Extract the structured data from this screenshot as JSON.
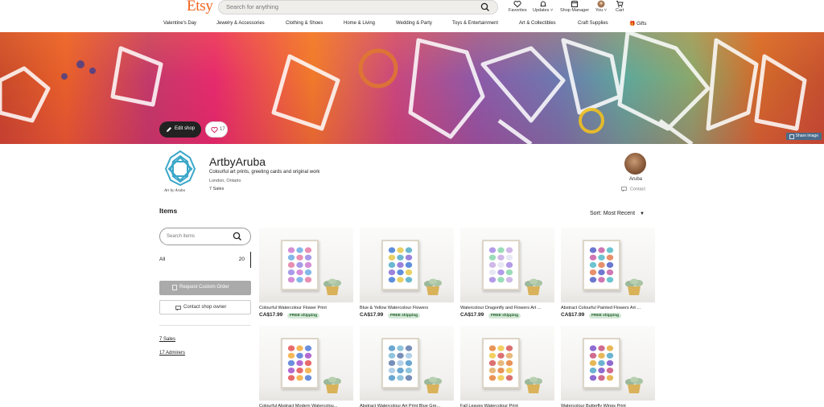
{
  "header": {
    "logo": "Etsy",
    "search_placeholder": "Search for anything",
    "icons": [
      {
        "label": "Favorites",
        "icon": "heart-icon"
      },
      {
        "label": "Updates ˅",
        "icon": "bell-icon"
      },
      {
        "label": "Shop Manager",
        "icon": "shop-icon"
      },
      {
        "label": "You ˅",
        "icon": "avatar-icon"
      },
      {
        "label": "Cart",
        "icon": "cart-icon"
      }
    ]
  },
  "categories": [
    "Valentine's Day",
    "Jewelry & Accessories",
    "Clothing & Shoes",
    "Home & Living",
    "Wedding & Party",
    "Toys & Entertainment",
    "Art & Collectibles",
    "Craft Supplies",
    "Gifts"
  ],
  "banner": {
    "edit_shop": "Edit shop",
    "favorites_count": "17",
    "share_image": "Share image"
  },
  "shop": {
    "name": "ArtbyAruba",
    "tagline": "Colourful art prints, greeting cards and original work",
    "location": "London, Ontario",
    "sales": "7 Sales",
    "logo_text": "Art by Aruba",
    "owner_name": "Aruba",
    "contact": "Contact"
  },
  "sidebar": {
    "heading": "Items",
    "search_placeholder": "Search items",
    "all_label": "All",
    "all_count": "20",
    "request_custom": "Request Custom Order",
    "contact_owner": "Contact shop owner",
    "sales_link": "7 Sales",
    "admirers_link": "17 Admirers"
  },
  "sort": {
    "label": "Sort: Most Recent"
  },
  "listings": [
    {
      "title": "Colourful Watercolour Flower Print",
      "price": "CA$17.99",
      "shipping": "FREE shipping"
    },
    {
      "title": "Blue & Yellow Watercolour Flowers",
      "price": "CA$17.99",
      "shipping": "FREE shipping"
    },
    {
      "title": "Watercolour Dragonfly and Flowers Art ...",
      "price": "CA$17.99",
      "shipping": "FREE shipping"
    },
    {
      "title": "Abstract Colourful Painted Flowers Art ...",
      "price": "CA$17.99",
      "shipping": "FREE shipping"
    },
    {
      "title": "Colourful Abstract Modern Watercolou...",
      "price": "",
      "shipping": ""
    },
    {
      "title": "Abstract Watercolour Art Print Blue Gre...",
      "price": "",
      "shipping": ""
    },
    {
      "title": "Fall Leaves Watercolour Print",
      "price": "",
      "shipping": ""
    },
    {
      "title": "Watercolour Butterfly Wings Print",
      "price": "",
      "shipping": ""
    }
  ],
  "colors": {
    "brand": "#f1641e",
    "free_shipping_bg": "#d4e9d7",
    "button_dark": "#222222"
  }
}
